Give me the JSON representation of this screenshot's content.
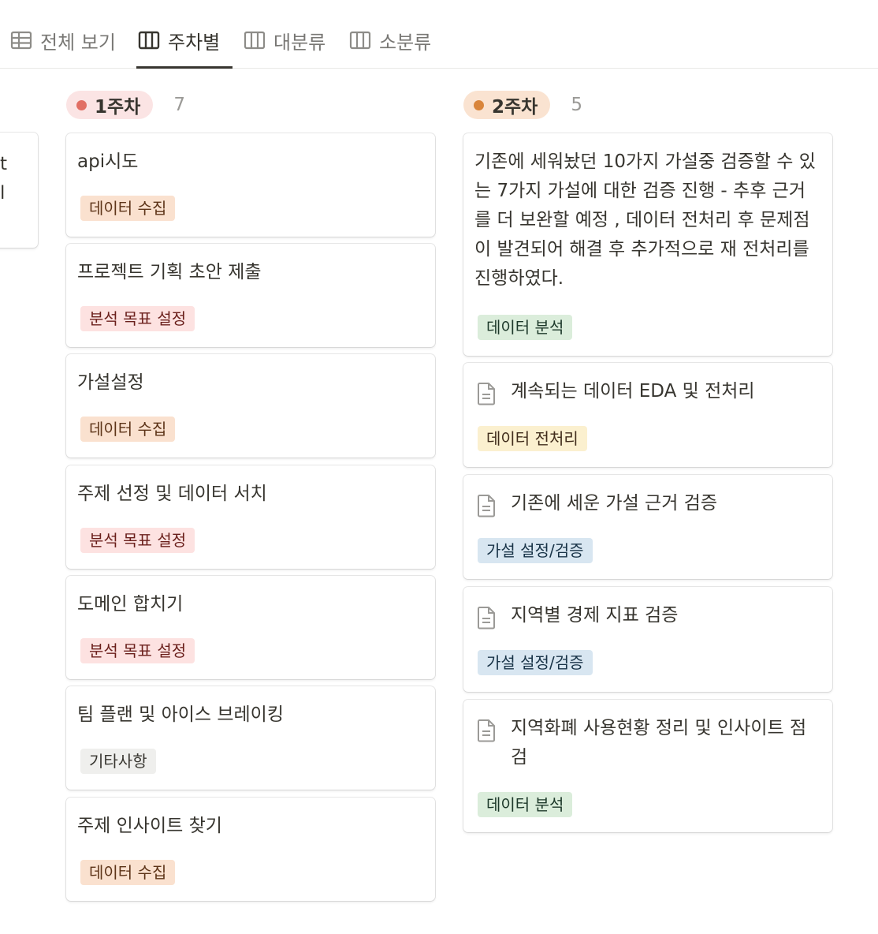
{
  "tabs": [
    {
      "label": "전체 보기",
      "icon": "table-icon",
      "active": false
    },
    {
      "label": "주차별",
      "icon": "board-icon",
      "active": true
    },
    {
      "label": "대분류",
      "icon": "board-icon",
      "active": false
    },
    {
      "label": "소분류",
      "icon": "board-icon",
      "active": false
    }
  ],
  "partial_card": {
    "line1": "t",
    "line2": "l"
  },
  "columns": [
    {
      "label": "1주차",
      "count": "7",
      "pill_bg": "#fbe4e4",
      "dot": "#e16f64",
      "cards": [
        {
          "title": "api시도",
          "tag": "데이터 수집"
        },
        {
          "title": "프로젝트 기획 초안 제출",
          "tag": "분석 목표 설정"
        },
        {
          "title": "가설설정",
          "tag": "데이터 수집"
        },
        {
          "title": "주제 선정 및 데이터 서치",
          "tag": "분석 목표 설정"
        },
        {
          "title": "도메인 합치기",
          "tag": "분석 목표 설정"
        },
        {
          "title": "팀 플랜 및 아이스 브레이킹",
          "tag": "기타사항"
        },
        {
          "title": "주제 인사이트 찾기",
          "tag": "데이터 수집"
        }
      ]
    },
    {
      "label": "2주차",
      "count": "5",
      "pill_bg": "#fae3d1",
      "dot": "#d9853b",
      "cards": [
        {
          "title": "기존에 세워놨던 10가지 가설중 검증할 수 있는 7가지 가설에 대한 검증 진행 - 추후 근거를 더 보완할 예정 , 데이터 전처리 후 문제점이 발견되어 해결 후 추가적으로 재 전처리를 진행하였다.",
          "tag": "데이터 분석"
        },
        {
          "title": "계속되는 데이터 EDA 및 전처리",
          "tag": "데이터 전처리",
          "icon": "document-icon"
        },
        {
          "title": "기존에 세운 가설 근거 검증",
          "tag": "가설 설정/검증",
          "icon": "document-icon"
        },
        {
          "title": "지역별 경제 지표 검증",
          "tag": "가설 설정/검증",
          "icon": "document-icon"
        },
        {
          "title": "지역화폐 사용현황 정리 및 인사이트 점검",
          "tag": "데이터 분석",
          "icon": "document-icon"
        }
      ]
    }
  ],
  "tag_colors": {
    "데이터 수집": {
      "bg": "#fae1cf",
      "fg": "#5d3418"
    },
    "분석 목표 설정": {
      "bg": "#fde2e1",
      "fg": "#6a1f1b"
    },
    "기타사항": {
      "bg": "#efefed",
      "fg": "#37352f"
    },
    "데이터 분석": {
      "bg": "#dbeddb",
      "fg": "#1c3829"
    },
    "데이터 전처리": {
      "bg": "#fbf0cf",
      "fg": "#402c1b"
    },
    "가설 설정/검증": {
      "bg": "#d8e6f1",
      "fg": "#183347"
    }
  }
}
